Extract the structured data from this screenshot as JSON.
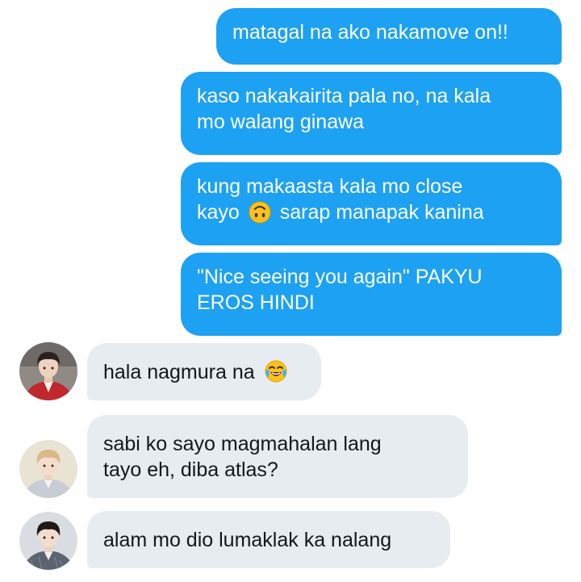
{
  "conversation": {
    "messages": [
      {
        "side": "sent",
        "lines": [
          "matagal na ako nakamove on!!"
        ]
      },
      {
        "side": "sent",
        "lines": [
          "kaso nakakairita pala no, na kala",
          "mo walang ginawa"
        ]
      },
      {
        "side": "sent",
        "lines": [
          "kung makaasta kala mo close",
          "kayo",
          "sarap manapak kanina"
        ],
        "emoji": "upside-down-face-icon"
      },
      {
        "side": "sent",
        "lines": [
          "\"Nice seeing you again\" PAKYU",
          "EROS HINDI"
        ]
      },
      {
        "side": "received",
        "lines": [
          "hala nagmura na"
        ],
        "emoji": "tears-of-joy-face-icon"
      },
      {
        "side": "received",
        "lines": [
          "sabi ko sayo magmahalan lang",
          "tayo eh, diba atlas?"
        ]
      },
      {
        "side": "received",
        "lines": [
          "alam mo dio lumaklak ka nalang"
        ]
      }
    ]
  },
  "colors": {
    "sent_bubble": "#1da1f2",
    "received_bubble": "#e6ecf0",
    "sent_text": "#ffffff",
    "received_text": "#14171a"
  }
}
